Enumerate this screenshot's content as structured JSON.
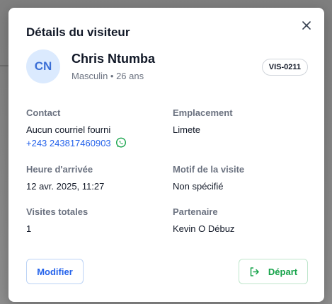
{
  "modal": {
    "title": "Détails du visiteur",
    "close_icon": "close-icon"
  },
  "visitor": {
    "initials": "CN",
    "name": "Chris Ntumba",
    "subinfo": "Masculin • 26 ans",
    "badge": "VIS-0211"
  },
  "fields": {
    "contact_label": "Contact",
    "contact_email": "Aucun courriel fourni",
    "contact_phone": "+243 243817460903",
    "location_label": "Emplacement",
    "location_value": "Limete",
    "arrival_label": "Heure d'arrivée",
    "arrival_value": "12 avr. 2025, 11:27",
    "reason_label": "Motif de la visite",
    "reason_value": "Non spécifié",
    "total_visits_label": "Visites totales",
    "total_visits_value": "1",
    "partner_label": "Partenaire",
    "partner_value": "Kevin O Débuz"
  },
  "actions": {
    "modify_label": "Modifier",
    "depart_label": "Départ"
  },
  "colors": {
    "accent_blue": "#2563eb",
    "success_green": "#16a34a",
    "whatsapp_green": "#25d366",
    "avatar_bg": "#dbeafe"
  },
  "icons": {
    "whatsapp": "whatsapp-icon",
    "depart": "logout-arrow-icon"
  }
}
